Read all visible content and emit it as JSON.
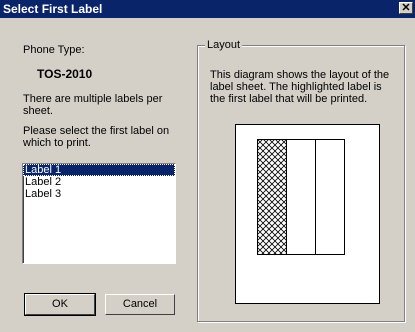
{
  "window": {
    "title": "Select First Label",
    "close_symbol": "✕"
  },
  "phone_type": {
    "caption": "Phone Type:",
    "value": "TOS-2010"
  },
  "instructions": {
    "multiple": "There are multiple labels per sheet.",
    "select": "Please select the first label on which to print."
  },
  "labels_list": {
    "items": [
      "Label 1",
      "Label 2",
      "Label 3"
    ],
    "selected": "Label 1"
  },
  "buttons": {
    "ok": "OK",
    "cancel": "Cancel"
  },
  "layout": {
    "legend": "Layout",
    "description": "This diagram shows the layout of the label sheet. The highlighted label is the first label that will be printed.",
    "highlighted_label": "Label 1"
  }
}
